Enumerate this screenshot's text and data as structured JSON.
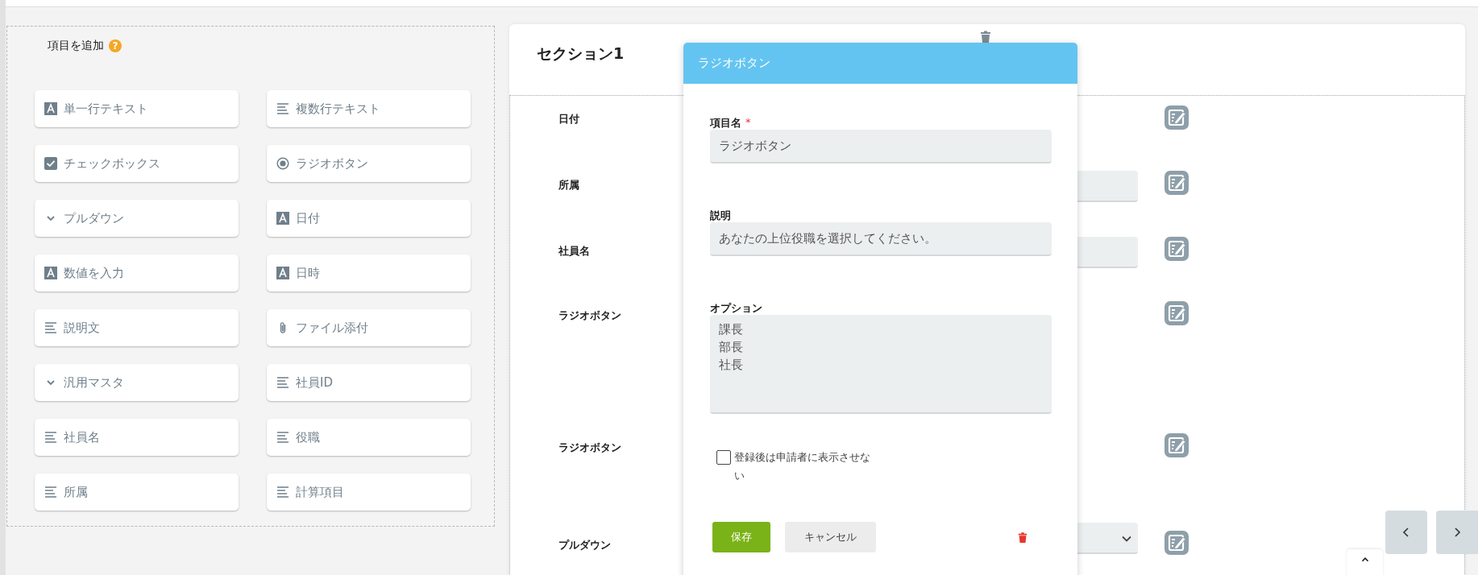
{
  "add_panel": {
    "title": "項目を追加",
    "help_icon": "?",
    "items": [
      {
        "label": "単一行テキスト",
        "kind": "text"
      },
      {
        "label": "複数行テキスト",
        "kind": "lines"
      },
      {
        "label": "チェックボックス",
        "kind": "checkbox"
      },
      {
        "label": "ラジオボタン",
        "kind": "radio"
      },
      {
        "label": "プルダウン",
        "kind": "dropdown"
      },
      {
        "label": "日付",
        "kind": "text"
      },
      {
        "label": "数値を入力",
        "kind": "text"
      },
      {
        "label": "日時",
        "kind": "text"
      },
      {
        "label": "説明文",
        "kind": "lines"
      },
      {
        "label": "ファイル添付",
        "kind": "attachment"
      },
      {
        "label": "汎用マスタ",
        "kind": "dropdown"
      },
      {
        "label": "社員ID",
        "kind": "lines"
      },
      {
        "label": "社員名",
        "kind": "lines"
      },
      {
        "label": "役職",
        "kind": "lines"
      },
      {
        "label": "所属",
        "kind": "lines"
      },
      {
        "label": "計算項目",
        "kind": "lines"
      }
    ]
  },
  "section": {
    "title": "セクション1",
    "fields": [
      {
        "label": "日付",
        "kind": "plain"
      },
      {
        "label": "所属",
        "kind": "input"
      },
      {
        "label": "社員名",
        "kind": "input"
      },
      {
        "label": "ラジオボタン",
        "kind": "plain"
      },
      {
        "label": "ラジオボタン",
        "kind": "plain"
      },
      {
        "label": "プルダウン",
        "kind": "select"
      }
    ]
  },
  "dialog": {
    "title": "ラジオボタン",
    "name_label": "項目名",
    "required_mark": "*",
    "name_value": "ラジオボタン",
    "description_label": "説明",
    "description_value": "あなたの上位役職を選択してください。",
    "options_label": "オプション",
    "options": [
      "課長",
      "部長",
      "社長"
    ],
    "hide_option": {
      "label": "登録後は申請者に表示させない",
      "checked": false
    },
    "save": "保存",
    "cancel": "キャンセル"
  }
}
